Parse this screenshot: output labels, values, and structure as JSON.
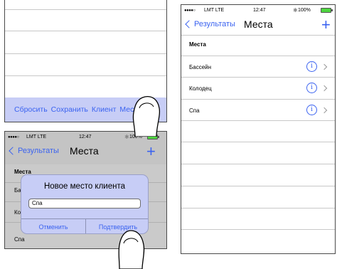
{
  "top_left": {
    "toolbar": {
      "reset": "Сбросить",
      "save": "Сохранить",
      "client": "Клиент",
      "places": "Места"
    }
  },
  "bottom_left": {
    "status": {
      "carrier": "LMT  LTE",
      "time": "12:47",
      "battery": "100%"
    },
    "nav": {
      "back": "Результаты",
      "title": "Места",
      "add": "+"
    },
    "list": {
      "header": "Места",
      "row1_partial": "Ба",
      "row2_partial": "Ко",
      "row3": "Спа"
    },
    "dialog": {
      "title": "Новое место клиента",
      "input_value": "Спа",
      "cancel": "Отменить",
      "confirm": "Подтвердить"
    }
  },
  "right": {
    "status": {
      "carrier": "LMT  LTE",
      "time": "12:47",
      "battery": "100%"
    },
    "nav": {
      "back": "Результаты",
      "title": "Места",
      "add": "+"
    },
    "list": {
      "header": "Места",
      "items": [
        {
          "label": "Бассейн"
        },
        {
          "label": "Колодец"
        },
        {
          "label": "Спа"
        }
      ]
    }
  },
  "colors": {
    "accent": "#3b63f0",
    "toolbar_bg": "#c7cdf6",
    "battery": "#4ed640"
  }
}
